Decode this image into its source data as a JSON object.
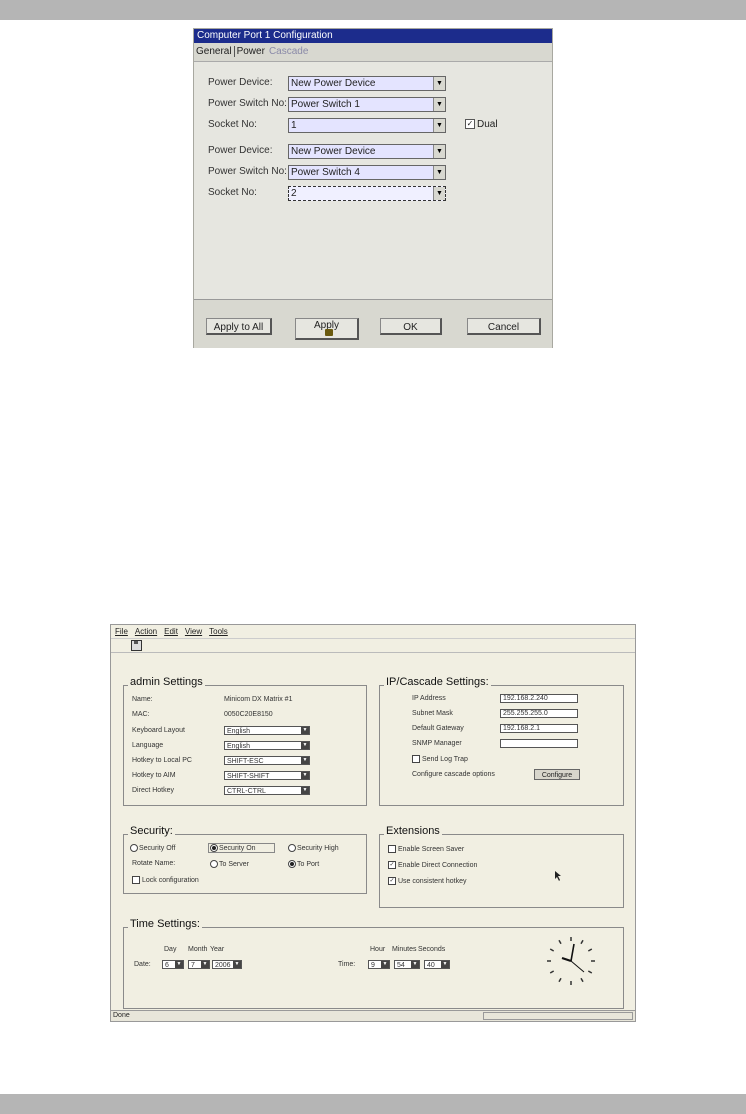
{
  "dialog": {
    "title": "Computer Port 1 Configuration",
    "tabs": [
      "General",
      "Power",
      "Cascade"
    ],
    "rows": [
      {
        "label": "Power Device:",
        "value": "New Power Device"
      },
      {
        "label": "Power Switch No:",
        "value": "Power Switch 1"
      },
      {
        "label": "Socket No:",
        "value": "1"
      },
      {
        "label": "Power Device:",
        "value": "New Power Device"
      },
      {
        "label": "Power Switch No:",
        "value": "Power Switch 4"
      },
      {
        "label": "Socket No:",
        "value": "2"
      }
    ],
    "dual_label": "Dual",
    "buttons": {
      "apply_all": "Apply to All",
      "apply": "Apply",
      "ok": "OK",
      "cancel": "Cancel"
    }
  },
  "window": {
    "menu": [
      "File",
      "Action",
      "Edit",
      "View",
      "Tools"
    ],
    "admin": {
      "title": "admin Settings",
      "name_label": "Name:",
      "name_value": "Minicom DX Matrix #1",
      "mac_label": "MAC:",
      "mac_value": "0050C20E8150",
      "keyboard_label": "Keyboard Layout",
      "keyboard_value": "English",
      "language_label": "Language",
      "language_value": "English",
      "hotkey_local_label": "Hotkey to Local PC",
      "hotkey_local_value": "SHIFT-ESC",
      "hotkey_aim_label": "Hotkey to AIM",
      "hotkey_aim_value": "SHIFT-SHIFT",
      "direct_hotkey_label": "Direct Hotkey",
      "direct_hotkey_value": "CTRL-CTRL"
    },
    "ip": {
      "title": "IP/Cascade Settings:",
      "ip_label": "IP Address",
      "ip_value": "192.168.2.240",
      "mask_label": "Subnet Mask",
      "mask_value": "255.255.255.0",
      "gateway_label": "Default Gateway",
      "gateway_value": "192.168.2.1",
      "snmp_label": "SNMP Manager",
      "snmp_value": "",
      "log_trap_label": "Send Log Trap",
      "cascade_label": "Configure cascade options",
      "configure_button": "Configure"
    },
    "security": {
      "title": "Security:",
      "off": "Security Off",
      "on": "Security On",
      "high": "Security High",
      "rotate_label": "Rotate Name:",
      "to_server": "To Server",
      "to_port": "To Port",
      "lock_label": "Lock configuration"
    },
    "extensions": {
      "title": "Extensions",
      "screen_saver": "Enable Screen Saver",
      "direct_connection": "Enable Direct Connection",
      "consistent_hotkey": "Use consistent hotkey"
    },
    "time": {
      "title": "Time Settings:",
      "day_label": "Day",
      "month_label": "Month",
      "year_label": "Year",
      "date_label": "Date:",
      "day": "6",
      "month": "7",
      "year": "2006",
      "hour_label": "Hour",
      "minutes_label": "Minutes",
      "seconds_label": "Seconds",
      "time_label": "Time:",
      "hour": "9",
      "minutes": "54",
      "seconds": "40"
    },
    "status": "Done"
  }
}
